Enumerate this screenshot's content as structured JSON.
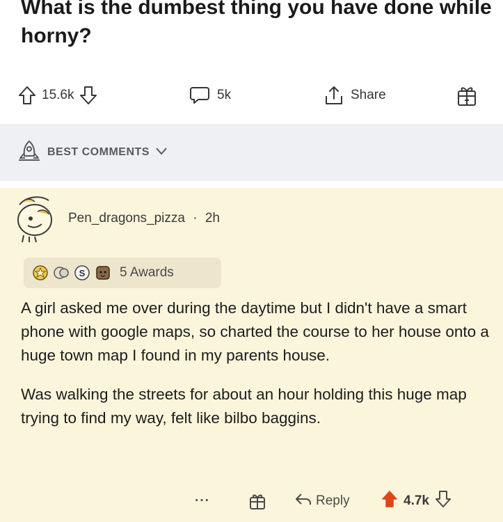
{
  "post": {
    "title": "What is the dumbest thing you have done while horny?"
  },
  "actions": {
    "upvotes": "15.6k",
    "comments": "5k",
    "share_label": "Share"
  },
  "sort": {
    "label": "BEST COMMENTS"
  },
  "comment": {
    "author": "Pen_dragons_pizza",
    "separator": "·",
    "age": "2h",
    "awards_label": "5 Awards",
    "paragraphs": [
      "A girl asked me over during the daytime but I didn't have a smart phone with google maps, so charted the course to her house onto a huge town map I found in my parents house.",
      "Was walking the streets for about an hour holding this huge map trying to find my way, felt like bilbo baggins."
    ],
    "more_label": "···",
    "reply_label": "Reply",
    "votes": "4.7k"
  },
  "icons": {
    "upvote": "upvote-arrow-icon",
    "downvote": "downvote-arrow-icon",
    "comment": "speech-bubble-icon",
    "share": "share-icon",
    "award": "gift-box-icon",
    "sort": "rocket-icon",
    "chevron": "chevron-down-icon",
    "reply": "reply-arrow-icon"
  },
  "colors": {
    "upvote_active": "#e0441a",
    "card_background": "#fbf5dc",
    "sort_bar_background": "#eef0f4"
  }
}
